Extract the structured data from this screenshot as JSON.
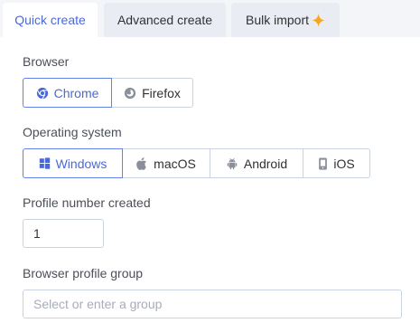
{
  "tabs": [
    {
      "label": "Quick create",
      "active": true
    },
    {
      "label": "Advanced create",
      "active": false
    },
    {
      "label": "Bulk import",
      "active": false,
      "icon": "sparkle-icon"
    }
  ],
  "browser": {
    "label": "Browser",
    "options": [
      {
        "label": "Chrome",
        "icon": "chrome-icon",
        "selected": true
      },
      {
        "label": "Firefox",
        "icon": "firefox-icon",
        "selected": false
      }
    ]
  },
  "os": {
    "label": "Operating system",
    "options": [
      {
        "label": "Windows",
        "icon": "windows-icon",
        "selected": true
      },
      {
        "label": "macOS",
        "icon": "apple-icon",
        "selected": false
      },
      {
        "label": "Android",
        "icon": "android-icon",
        "selected": false
      },
      {
        "label": "iOS",
        "icon": "ios-device-icon",
        "selected": false
      }
    ]
  },
  "profile_number": {
    "label": "Profile number created",
    "value": "1"
  },
  "group": {
    "label": "Browser profile group",
    "placeholder": "Select or enter a group",
    "value": ""
  },
  "colors": {
    "accent": "#4a69d8",
    "active_border": "#6384e6",
    "border": "#c9d3e1",
    "tab_bar": "#f3f5f9",
    "sparkle": "#f5a623"
  }
}
